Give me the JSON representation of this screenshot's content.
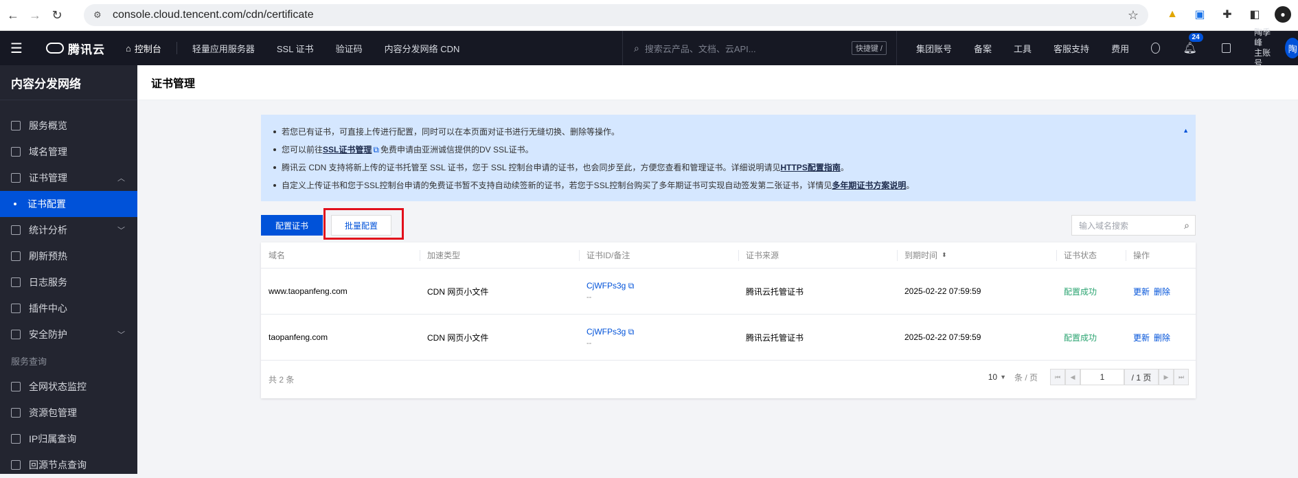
{
  "browser": {
    "url": "console.cloud.tencent.com/cdn/certificate"
  },
  "topnav": {
    "brand": "腾讯云",
    "console": "控制台",
    "items": [
      "轻量应用服务器",
      "SSL 证书",
      "验证码",
      "内容分发网络 CDN"
    ],
    "search_placeholder": "搜索云产品、文档、云API...",
    "shortcut": "快捷键 /",
    "right_items": [
      "集团账号",
      "备案",
      "工具",
      "客服支持",
      "费用"
    ],
    "notification_count": "24",
    "account_name": "陶季峰",
    "account_role": "主账号",
    "avatar_initial": "陶"
  },
  "sidebar": {
    "title": "内容分发网络",
    "items": [
      {
        "label": "服务概览"
      },
      {
        "label": "域名管理"
      },
      {
        "label": "证书管理"
      },
      {
        "label": "证书配置"
      },
      {
        "label": "统计分析"
      },
      {
        "label": "刷新预热"
      },
      {
        "label": "日志服务"
      },
      {
        "label": "插件中心"
      },
      {
        "label": "安全防护"
      }
    ],
    "group_label": "服务查询",
    "group_items": [
      {
        "label": "全网状态监控"
      },
      {
        "label": "资源包管理"
      },
      {
        "label": "IP归属查询"
      },
      {
        "label": "回源节点查询"
      }
    ]
  },
  "page": {
    "title": "证书管理"
  },
  "notice": {
    "line1": "若您已有证书，可直接上传进行配置，同时可以在本页面对证书进行无缝切换、删除等操作。",
    "line2_pre": "您可以前往",
    "line2_link": "SSL证书管理",
    "line2_post": " 免费申请由亚洲诚信提供的DV SSL证书。",
    "line3_pre": "腾讯云 CDN 支持将新上传的证书托管至 SSL 证书，您于 SSL 控制台申请的证书，也会同步至此，方便您查看和管理证书。详细说明请见 ",
    "line3_link": "HTTPS配置指南",
    "line3_post": "。",
    "line4_pre": "自定义上传证书和您于SSL控制台申请的免费证书暂不支持自动续签新的证书，若您于SSL控制台购买了多年期证书可实现自动签发第二张证书，详情见 ",
    "line4_link": "多年期证书方案说明",
    "line4_post": "。"
  },
  "toolbar": {
    "configure_label": "配置证书",
    "batch_label": "批量配置",
    "search_placeholder": "输入域名搜索"
  },
  "table": {
    "headers": [
      "域名",
      "加速类型",
      "证书ID/备注",
      "证书来源",
      "到期时间",
      "证书状态",
      "操作"
    ],
    "rows": [
      {
        "domain": "www.taopanfeng.com",
        "type": "CDN 网页小文件",
        "cert_id": "CjWFPs3g",
        "cert_note": "--",
        "source": "腾讯云托管证书",
        "expiry": "2025-02-22 07:59:59",
        "status": "配置成功",
        "op_update": "更新",
        "op_delete": "删除"
      },
      {
        "domain": "taopanfeng.com",
        "type": "CDN 网页小文件",
        "cert_id": "CjWFPs3g",
        "cert_note": "--",
        "source": "腾讯云托管证书",
        "expiry": "2025-02-22 07:59:59",
        "status": "配置成功",
        "op_update": "更新",
        "op_delete": "删除"
      }
    ],
    "total": "共 2 条",
    "page_size": "10",
    "page_size_unit": "条 / 页",
    "current_page": "1",
    "total_pages": "/ 1 页"
  },
  "colors": {
    "primary": "#0052d9",
    "success": "#2ba471",
    "highlight": "#e20f1b",
    "notice_bg": "#d5e7ff"
  }
}
